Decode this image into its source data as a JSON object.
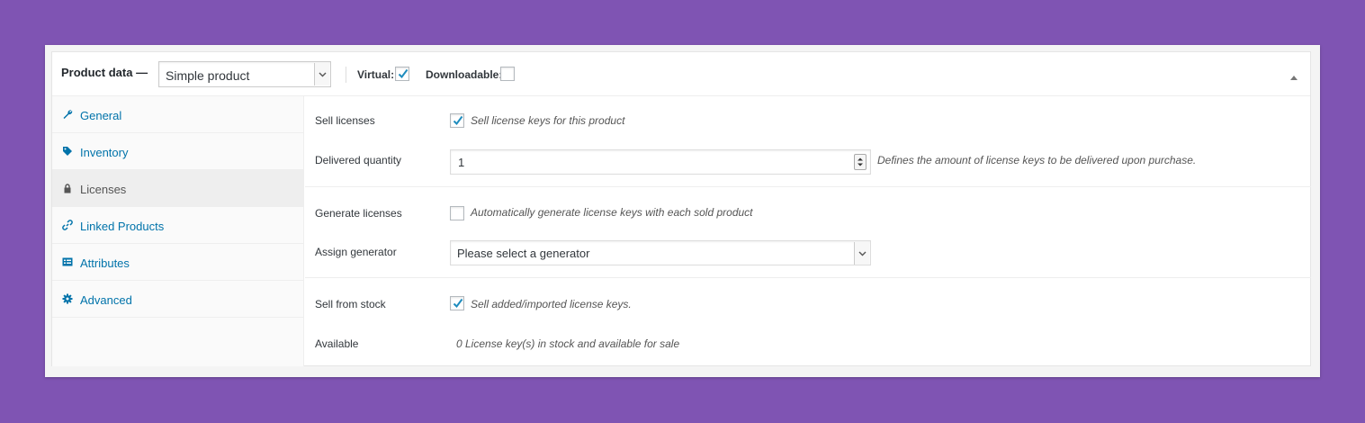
{
  "header": {
    "title": "Product data —",
    "product_type": "Simple product",
    "virtual_label": "Virtual:",
    "virtual_checked": true,
    "downloadable_label": "Downloadable:",
    "downloadable_checked": false
  },
  "tabs": [
    {
      "label": "General",
      "icon": "wrench-icon",
      "active": false
    },
    {
      "label": "Inventory",
      "icon": "tag-icon",
      "active": false
    },
    {
      "label": "Licenses",
      "icon": "lock-icon",
      "active": true
    },
    {
      "label": "Linked Products",
      "icon": "link-icon",
      "active": false
    },
    {
      "label": "Attributes",
      "icon": "list-icon",
      "active": false
    },
    {
      "label": "Advanced",
      "icon": "gear-icon",
      "active": false
    }
  ],
  "licenses": {
    "sell_licenses": {
      "label": "Sell licenses",
      "checked": true,
      "description": "Sell license keys for this product"
    },
    "delivered_quantity": {
      "label": "Delivered quantity",
      "value": "1",
      "description": "Defines the amount of license keys to be delivered upon purchase."
    },
    "generate_licenses": {
      "label": "Generate licenses",
      "checked": false,
      "description": "Automatically generate license keys with each sold product"
    },
    "assign_generator": {
      "label": "Assign generator",
      "value": "Please select a generator"
    },
    "sell_from_stock": {
      "label": "Sell from stock",
      "checked": true,
      "description": "Sell added/imported license keys."
    },
    "available": {
      "label": "Available",
      "value": "0 License key(s) in stock and available for sale"
    }
  },
  "colors": {
    "background": "#7f54b3",
    "link": "#0073aa",
    "check": "#1e8cbe"
  }
}
